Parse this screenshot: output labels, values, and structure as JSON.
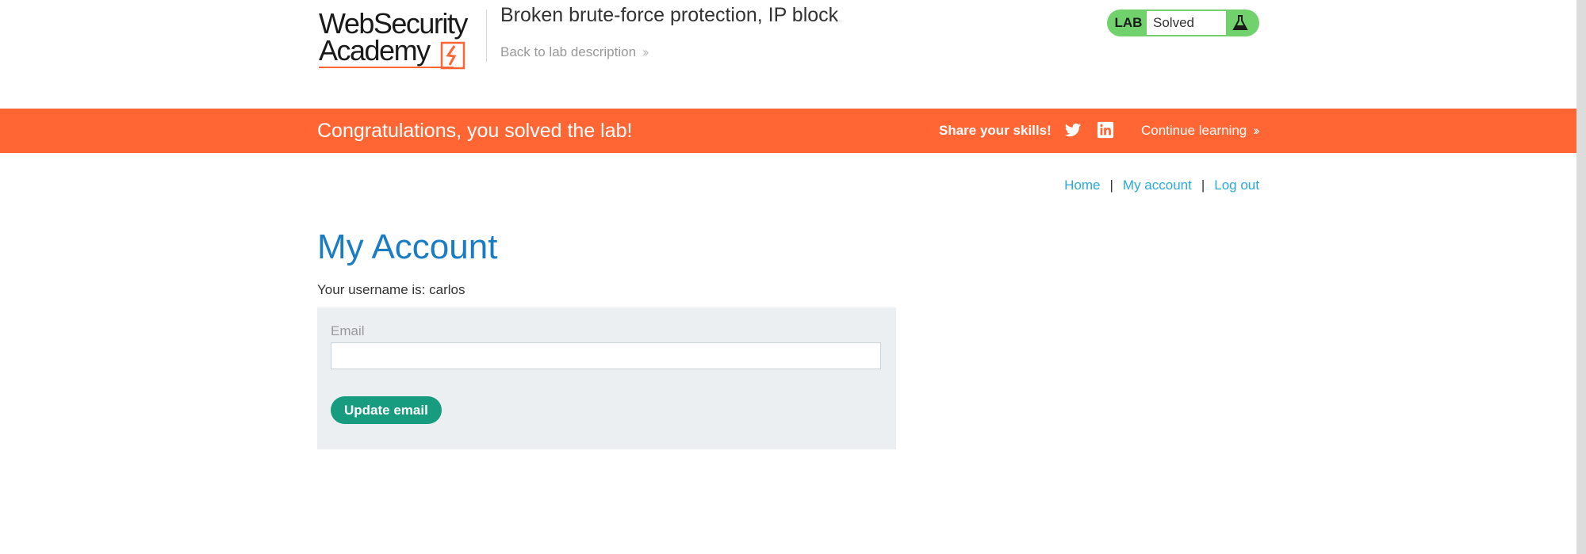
{
  "header": {
    "logo_line1": "WebSecurity",
    "logo_line2": "Academy",
    "lab_title": "Broken brute-force protection, IP block",
    "back_link": "Back to lab description",
    "lab_badge": "LAB",
    "lab_status": "Solved"
  },
  "banner": {
    "message": "Congratulations, you solved the lab!",
    "share_label": "Share your skills!",
    "continue_link": "Continue learning"
  },
  "nav": {
    "home": "Home",
    "sep1": "|",
    "my_account": "My account",
    "sep2": "|",
    "log_out": "Log out"
  },
  "main": {
    "page_title": "My Account",
    "username_line": "Your username is: carlos",
    "email_label": "Email",
    "email_value": "",
    "update_button": "Update email"
  },
  "colors": {
    "brand_orange": "#ff6633",
    "link_blue": "#29a9e0",
    "title_blue": "#1a7dc4",
    "solved_green": "#70d16d",
    "button_teal": "#189c7f",
    "panel_bg": "#ebeff2"
  },
  "icons": {
    "logo_mark": "lightning-bolt-icon",
    "lab_status": "flask-icon",
    "share_twitter": "twitter-icon",
    "share_linkedin": "linkedin-icon",
    "chevron": "double-chevron-right-icon"
  }
}
